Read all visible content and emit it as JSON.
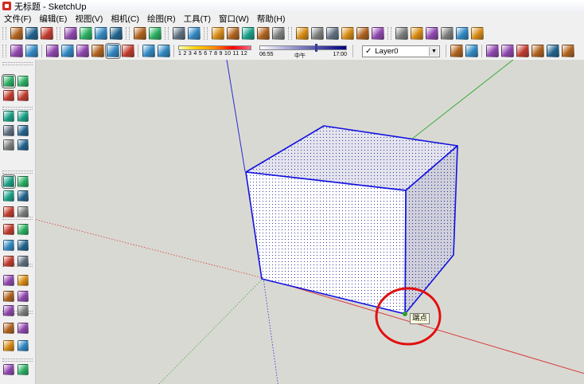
{
  "window": {
    "title": "无标题 - SketchUp",
    "icon": "sketchup-logo-icon"
  },
  "menu": [
    "文件(F)",
    "编辑(E)",
    "视图(V)",
    "相机(C)",
    "绘图(R)",
    "工具(T)",
    "窗口(W)",
    "帮助(H)"
  ],
  "toolbar1": {
    "groups": [
      [
        "new-icon",
        "open-icon",
        "save-icon"
      ],
      [
        "cut-icon",
        "copy-icon",
        "paste-icon",
        "erase-icon"
      ],
      [
        "undo-icon",
        "redo-icon"
      ],
      [
        "print-icon",
        "model-info-icon"
      ],
      [
        "display-mode-icon",
        "top-view-icon",
        "front-view-icon",
        "right-view-icon",
        "back-view-icon"
      ],
      [
        "xray-icon",
        "back-edges-icon",
        "wireframe-icon",
        "hidden-line-icon",
        "shaded-icon",
        "textured-icon"
      ],
      [
        "iso-view-icon",
        "top-icon",
        "front-icon",
        "right-icon",
        "back-icon",
        "left-icon"
      ]
    ]
  },
  "toolbar2": {
    "left_groups": [
      [
        "component-icon",
        "group-icon"
      ],
      [
        "xray-mode-icon",
        "wireframe-mode-icon",
        "hidden-line-mode-icon",
        "shaded-mode-icon",
        "shaded-texture-mode-icon",
        "monochrome-mode-icon"
      ],
      [
        "shadows-toggle-icon",
        "fog-toggle-icon"
      ]
    ],
    "shadow_months": "1 2 3 4 5 6 7 8 9 10 11 12",
    "time_start": "06:55",
    "time_mid": "中午",
    "time_end": "17:00",
    "layer": {
      "check": "✓",
      "name": "Layer0"
    },
    "right_groups": [
      [
        "layer-manager-icon",
        "layer-color-icon"
      ],
      [
        "sandbox-from-contours-icon",
        "sandbox-scratch-icon",
        "smoove-icon",
        "stamp-icon",
        "drape-icon",
        "flip-edge-icon"
      ]
    ]
  },
  "sidebar": {
    "rows": [
      [
        "select-icon",
        "make-component-icon"
      ],
      [
        "paint-bucket-icon",
        "eraser-icon"
      ],
      [
        "rectangle-icon",
        "line-icon"
      ],
      [
        "circle-icon",
        "freehand-icon"
      ],
      [
        "polygon-icon",
        "arc-icon"
      ],
      [
        "move-icon",
        "push-pull-icon"
      ],
      [
        "rotate-icon",
        "follow-me-icon"
      ],
      [
        "scale-icon",
        "offset-icon"
      ],
      [
        "tape-measure-icon",
        "dimension-icon"
      ],
      [
        "protractor-icon",
        "text-icon"
      ],
      [
        "axes-icon",
        "3d-text-icon"
      ],
      [
        "orbit-icon",
        "pan-icon"
      ],
      [
        "zoom-icon",
        "zoom-window-icon"
      ],
      [
        "zoom-extents-icon",
        "previous-view-icon"
      ],
      [
        "position-camera-icon",
        "look-around-icon"
      ],
      [
        "walk-icon",
        "section-plane-icon"
      ],
      [
        "extra-tool-icon",
        "extra-tool-2-icon"
      ]
    ],
    "active": [
      "select-icon",
      "move-icon"
    ]
  },
  "colors": {
    "edge": "#1212e0",
    "axis_red": "#d83a3a",
    "axis_green": "#3aaa3a",
    "axis_blue": "#2a2ad6",
    "highlight_circle": "#e01010",
    "endpoint": "#2aa02a"
  },
  "tooltip": {
    "text": "端点"
  }
}
